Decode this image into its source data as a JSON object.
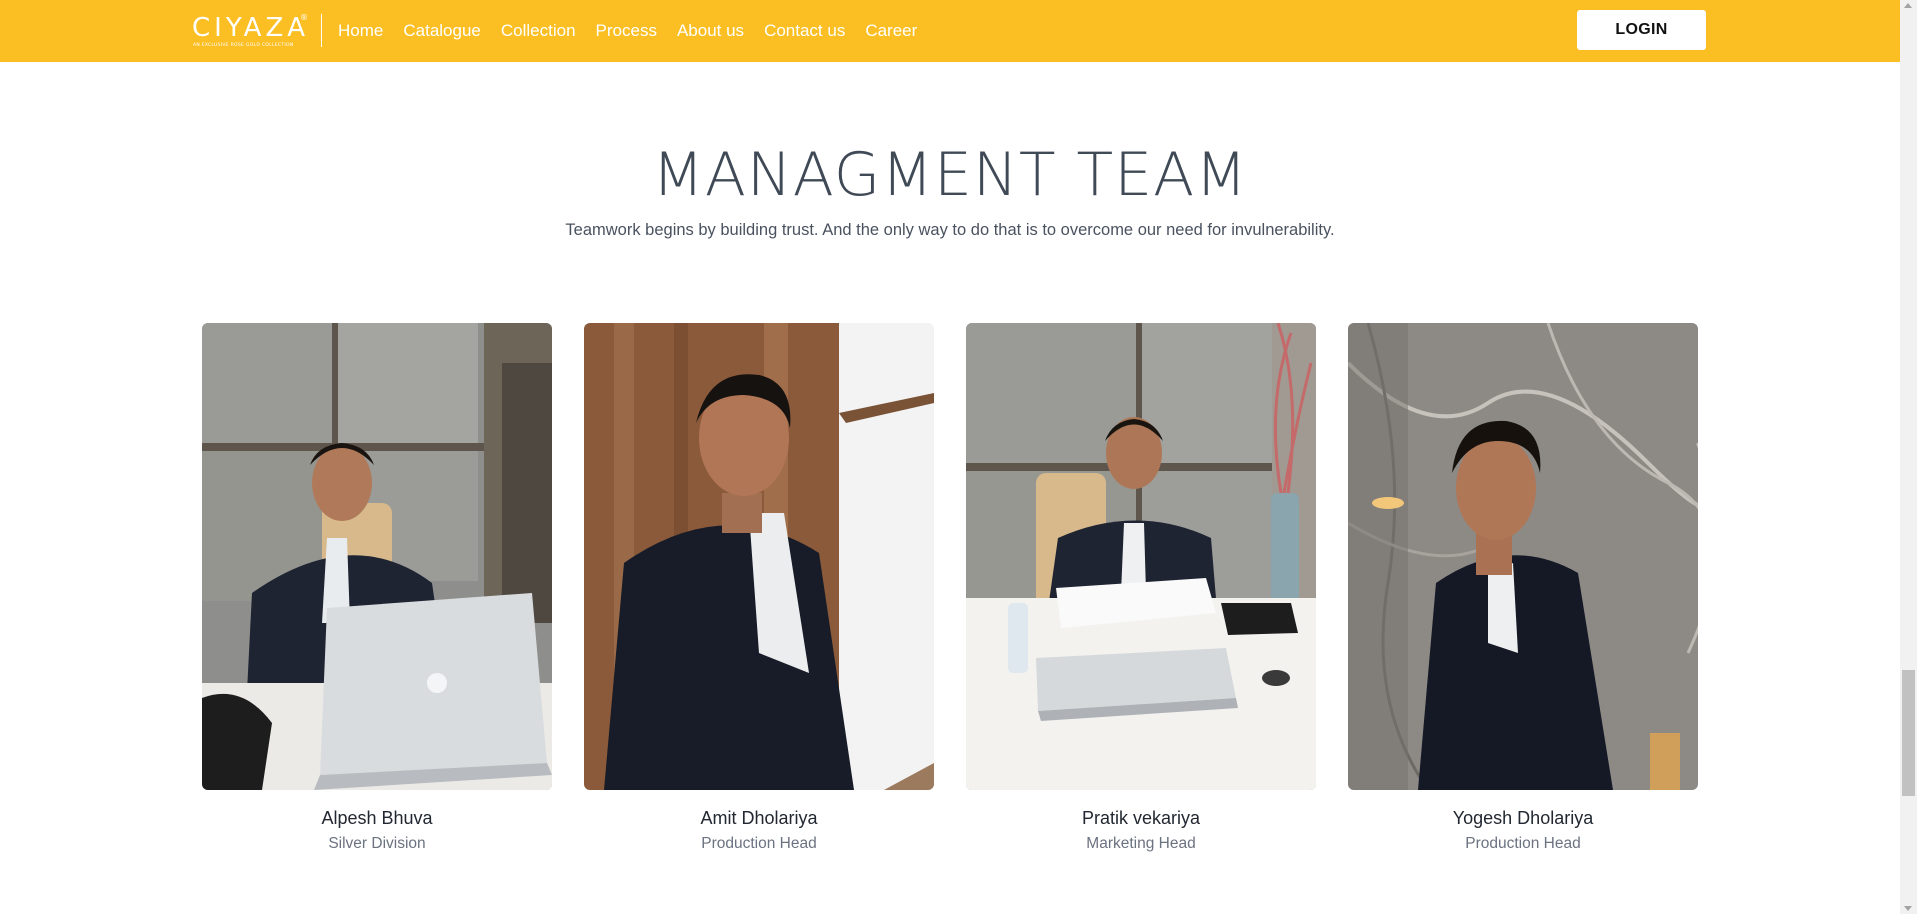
{
  "brand": {
    "logo_text": "CIYAZA",
    "logo_mark": "®",
    "tagline": "AN EXCLUSIVE ROSE GOLD COLLECTION"
  },
  "nav": {
    "links": [
      "Home",
      "Catalogue",
      "Collection",
      "Process",
      "About us",
      "Contact us",
      "Career"
    ],
    "login_label": "LOGIN"
  },
  "section": {
    "title": "MANAGMENT TEAM",
    "subtitle": "Teamwork begins by building trust. And the only way to do that is to overcome our need for invulnerability."
  },
  "team": [
    {
      "name": "Alpesh Bhuva",
      "role": "Silver Division",
      "photo": "man-at-desk-with-laptop"
    },
    {
      "name": "Amit Dholariya",
      "role": "Production Head",
      "photo": "man-portrait-wood-wall"
    },
    {
      "name": "Pratik vekariya",
      "role": "Marketing Head",
      "photo": "man-at-desk-with-laptop-and-bottle"
    },
    {
      "name": "Yogesh Dholariya",
      "role": "Production Head",
      "photo": "man-portrait-marble-wall"
    }
  ],
  "colors": {
    "nav_background": "#fbbf24",
    "title": "#404a57",
    "role_text": "#6b7280"
  }
}
